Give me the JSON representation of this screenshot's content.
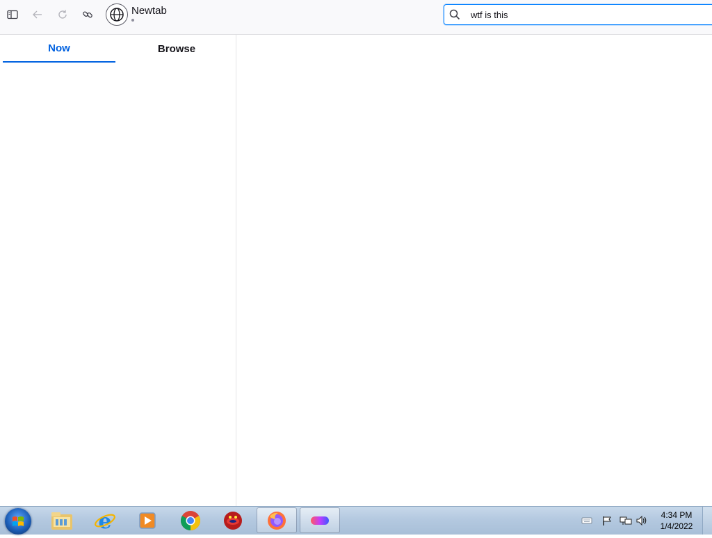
{
  "toolbar": {
    "sidebar_toggle_icon": "sidebar-icon",
    "back_icon": "arrow-left-icon",
    "reload_icon": "reload-icon",
    "link_icon": "link-icon",
    "site_icon": "globe-icon",
    "site_title": "Newtab"
  },
  "search": {
    "value": "wtf is this",
    "icon": "search-icon"
  },
  "sidebar": {
    "tabs": [
      {
        "label": "Now",
        "active": true
      },
      {
        "label": "Browse",
        "active": false
      }
    ]
  },
  "taskbar": {
    "start_icon": "windows-start-icon",
    "apps": [
      {
        "name": "file-explorer-icon"
      },
      {
        "name": "internet-explorer-icon"
      },
      {
        "name": "media-player-icon"
      },
      {
        "name": "chrome-icon"
      },
      {
        "name": "red-app-icon"
      },
      {
        "name": "firefox-icon",
        "active": true
      },
      {
        "name": "pill-app-icon",
        "active": true
      }
    ],
    "tray": [
      "keyboard-icon",
      "flag-icon",
      "network-icon",
      "volume-icon"
    ],
    "clock": {
      "time": "4:34 PM",
      "date": "1/4/2022"
    }
  },
  "colors": {
    "accent": "#0061e0",
    "focus_ring": "#0a84ff",
    "toolbar_bg": "#f9f9fb"
  }
}
